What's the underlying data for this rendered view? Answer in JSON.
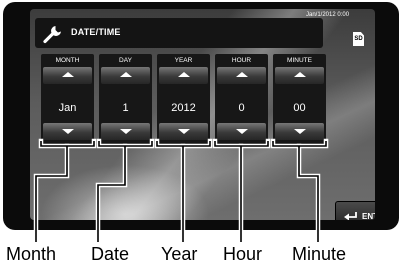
{
  "header": {
    "title": "DATE/TIME",
    "datetime": "Jan/1/2012 0:00",
    "sd_label": "SD"
  },
  "columns": [
    {
      "key": "month",
      "header": "MONTH",
      "value": "Jan"
    },
    {
      "key": "day",
      "header": "DAY",
      "value": "1"
    },
    {
      "key": "year",
      "header": "YEAR",
      "value": "2012"
    },
    {
      "key": "hour",
      "header": "HOUR",
      "value": "0"
    },
    {
      "key": "minute",
      "header": "MINUTE",
      "value": "00"
    }
  ],
  "enter": {
    "label": "ENTER"
  },
  "callout_labels": [
    "Month",
    "Date",
    "Year",
    "Hour",
    "Minute"
  ],
  "colors": {
    "panel": "#171717",
    "bezel": "#0b0b0b",
    "text": "#ffffff"
  }
}
